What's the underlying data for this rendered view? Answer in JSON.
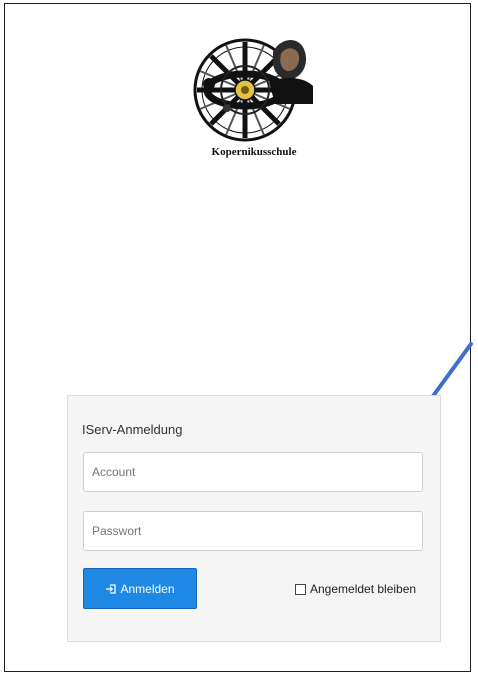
{
  "logo": {
    "caption": "Kopernikusschule"
  },
  "login": {
    "title": "IServ-Anmeldung",
    "account_placeholder": "Account",
    "password_placeholder": "Passwort",
    "submit_label": "Anmelden",
    "remember_label": "Angemeldet bleiben"
  },
  "colors": {
    "button": "#1e88e5",
    "arrow": "#3a6fd0"
  },
  "icons": {
    "submit": "sign-in-icon",
    "annotation": "pointer-arrow"
  }
}
